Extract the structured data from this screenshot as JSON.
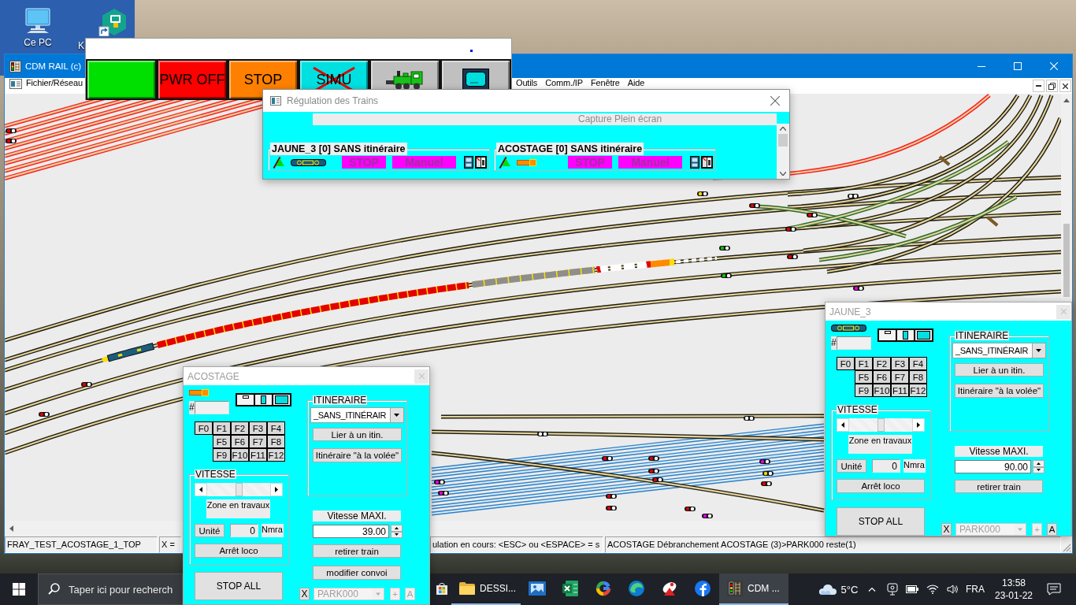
{
  "desktop": {
    "icons": [
      {
        "kind": "computer",
        "label": "Ce PC"
      },
      {
        "kind": "shortcut",
        "label": "K"
      }
    ]
  },
  "toolbar": {
    "buttons": [
      {
        "kind": "blank",
        "color": "#00e000",
        "crossed": false
      },
      {
        "kind": "text",
        "label": "PWR OFF",
        "color": "#ff0000",
        "crossed": false
      },
      {
        "kind": "text",
        "label": "STOP",
        "color": "#ff8000",
        "crossed": false
      },
      {
        "kind": "text",
        "label": "SIMU",
        "color": "#00e0e0",
        "crossed": true
      },
      {
        "kind": "locomotive",
        "color": "#c0c0c0",
        "crossed": false
      },
      {
        "kind": "monitor",
        "color": "#c0c0c0",
        "crossed": false
      }
    ]
  },
  "main_window": {
    "title": "CDM RAIL (c)",
    "menu": [
      "Fichier/Réseau",
      "Outils",
      "Comm./IP",
      "Fenêtre",
      "Aide"
    ],
    "status_bar": [
      "FRAY_TEST_ACOSTAGE_1_TOP",
      "X =",
      "ulation en cours: <ESC> ou <ESPACE> = s",
      "ACOSTAGE Débranchement ACOSTAGE (3)>PARK000 reste(1)"
    ]
  },
  "regulation": {
    "title": "Régulation des Trains",
    "banner": "Capture Plein écran",
    "trains": [
      {
        "name": "JAUNE_3 [0] SANS itinéraire",
        "kind": "railcar",
        "state": "STOP",
        "mode": "Manuel"
      },
      {
        "name": "ACOSTAGE [0] SANS itinéraire",
        "kind": "locomotive",
        "state": "STOP",
        "mode": "Manuel"
      }
    ]
  },
  "controls": [
    {
      "title": "ACOSTAGE",
      "kind": "locomotive",
      "number_prefix": "#",
      "functions": [
        "F0",
        "F1",
        "F2",
        "F3",
        "F4",
        "F5",
        "F6",
        "F7",
        "F8",
        "F9",
        "F10",
        "F11",
        "F12"
      ],
      "speed": {
        "label": "VITESSE",
        "level": 0.5,
        "zone": "Zone en travaux",
        "unit_button": "Unité",
        "unit_value": "0",
        "unit_label": "Nmra",
        "stop_button": "Arrêt loco"
      },
      "stop_all": "STOP ALL",
      "route": {
        "label": "ITINERAIRE",
        "value": "_SANS_ITINÉRAIR",
        "buttons": [
          "Lier à un itin.",
          "Itinéraire \"à la volée\""
        ]
      },
      "max_speed": {
        "label": "Vitesse MAXI.",
        "value": "39.00"
      },
      "actions": [
        "retirer train",
        "modifier convoi"
      ],
      "park": {
        "x_button": {
          "label": "X",
          "disabled": false
        },
        "select": {
          "value": "PARK000",
          "disabled": true
        },
        "plus_button": {
          "label": "+",
          "disabled": true
        },
        "a_button": {
          "label": "A",
          "disabled": true
        }
      }
    },
    {
      "title": "JAUNE_3",
      "kind": "railcar",
      "number_prefix": "#",
      "functions": [
        "F0",
        "F1",
        "F2",
        "F3",
        "F4",
        "F5",
        "F6",
        "F7",
        "F8",
        "F9",
        "F10",
        "F11",
        "F12"
      ],
      "speed": {
        "label": "VITESSE",
        "level": 0.5,
        "zone": "Zone en travaux",
        "unit_button": "Unité",
        "unit_value": "0",
        "unit_label": "Nmra",
        "stop_button": "Arrêt loco"
      },
      "stop_all": "STOP ALL",
      "route": {
        "label": "ITINERAIRE",
        "value": "_SANS_ITINÉRAIR",
        "buttons": [
          "Lier à un itin.",
          "Itinéraire \"à la volée\""
        ]
      },
      "max_speed": {
        "label": "Vitesse MAXI.",
        "value": "90.00"
      },
      "actions": [
        "retirer train"
      ],
      "park": {
        "x_button": {
          "label": "X",
          "disabled": false
        },
        "select": {
          "value": "PARK000",
          "disabled": true
        },
        "plus_button": {
          "label": "+",
          "disabled": true
        },
        "a_button": {
          "label": "A",
          "disabled": false
        }
      }
    }
  ],
  "taskbar": {
    "search": {
      "placeholder": "Taper ici pour recherch"
    },
    "apps": [
      {
        "kind": "store",
        "running": false,
        "selected": false
      },
      {
        "kind": "folder",
        "label": "DESSI...",
        "running": true,
        "selected": false
      },
      {
        "kind": "picture",
        "running": false,
        "selected": false
      },
      {
        "kind": "spreadsheet",
        "running": false,
        "selected": false
      },
      {
        "kind": "ring",
        "running": false,
        "selected": false
      },
      {
        "kind": "wave",
        "running": false,
        "selected": false
      },
      {
        "kind": "dish",
        "running": false,
        "selected": false
      },
      {
        "kind": "round-logo",
        "running": false,
        "selected": false
      },
      {
        "kind": "signal",
        "label": "CDM ...",
        "running": true,
        "selected": true
      }
    ],
    "weather": "5°C",
    "language": "FRA",
    "time": "13:58",
    "date": "23-01-22"
  }
}
